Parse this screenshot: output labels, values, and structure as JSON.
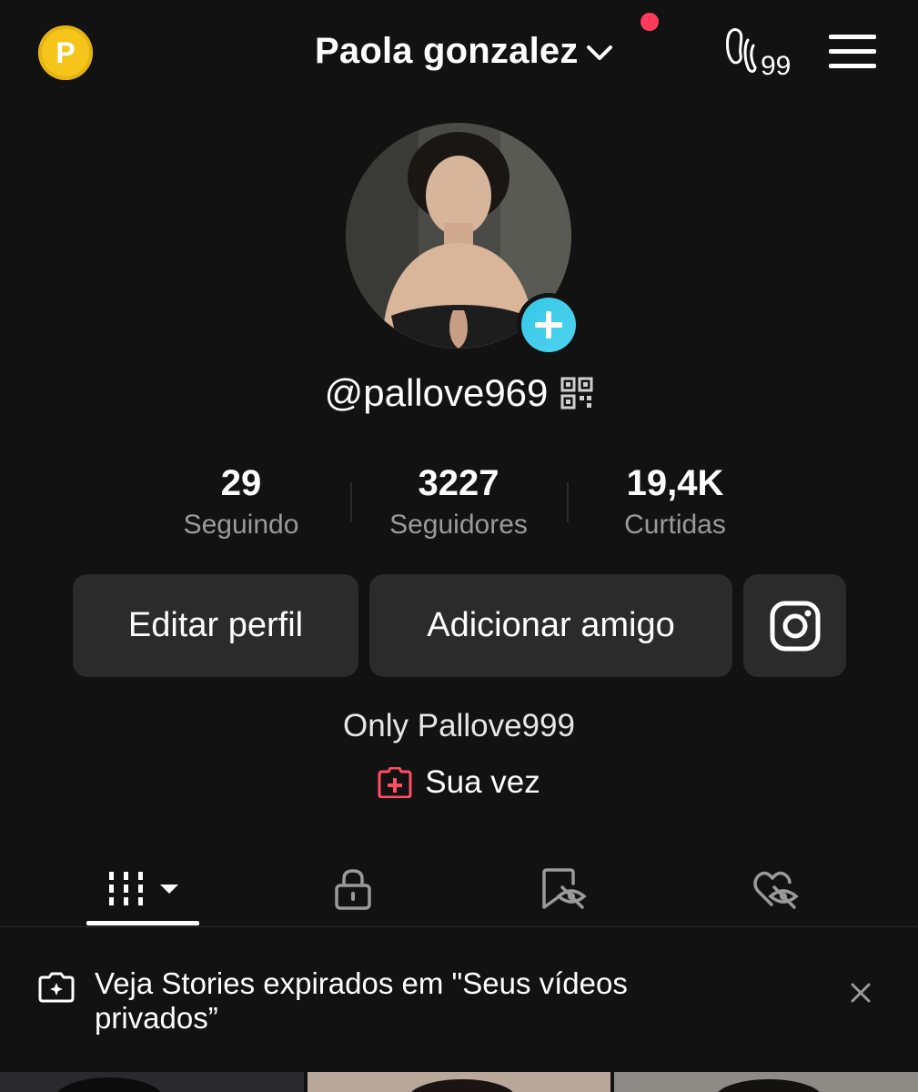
{
  "header": {
    "title": "Paola gonzalez",
    "coin_letter": "P",
    "activity_badge": "99"
  },
  "profile": {
    "username": "@pallove969",
    "bio": "Only Pallove999",
    "link_text": "Sua vez"
  },
  "stats": [
    {
      "value": "29",
      "label": "Seguindo"
    },
    {
      "value": "3227",
      "label": "Seguidores"
    },
    {
      "value": "19,4K",
      "label": "Curtidas"
    }
  ],
  "buttons": {
    "edit": "Editar perfil",
    "add_friend": "Adicionar amigo"
  },
  "notice": {
    "text": "Veja Stories expirados em \"Seus vídeos privados”"
  },
  "colors": {
    "background": "#121212",
    "coin": "#f5c51b",
    "notification": "#ff3b5c",
    "accent_cyan": "#36c8e8",
    "button_bg": "#2b2b2b",
    "secondary_text": "#9a9a9a"
  },
  "icons": [
    "coin-icon",
    "chevron-down-icon",
    "footprints-icon",
    "menu-icon",
    "plus-icon",
    "qr-code-icon",
    "instagram-icon",
    "add-to-profile-icon",
    "grid-icon",
    "caret-down-icon",
    "lock-icon",
    "bookmark-hidden-icon",
    "heart-hidden-icon",
    "stories-camera-icon",
    "close-icon"
  ]
}
